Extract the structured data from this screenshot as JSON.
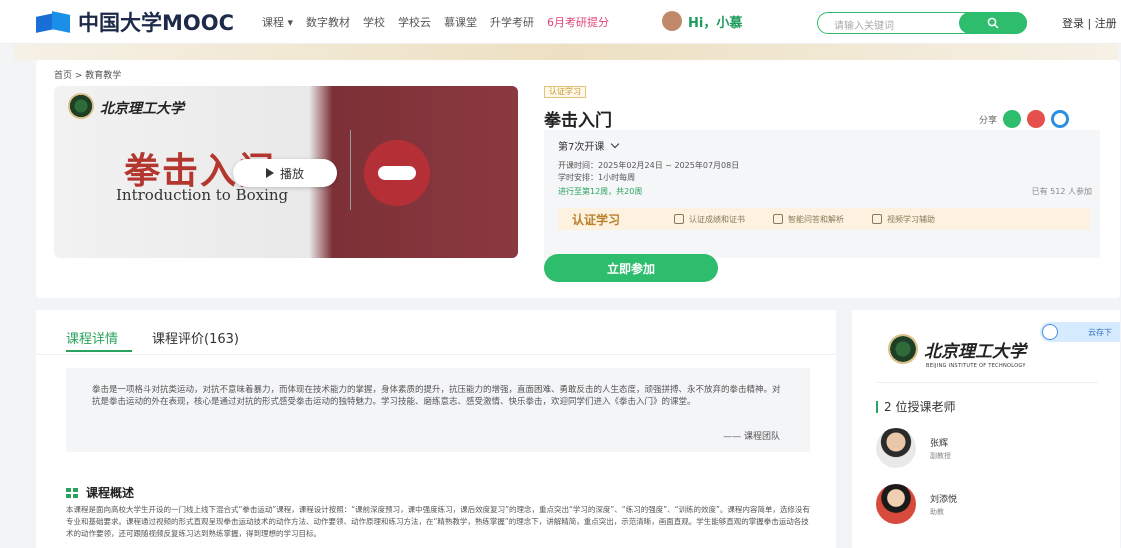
{
  "brand": {
    "logo_text": "中国大学MOOC"
  },
  "nav": {
    "items": [
      "课程 ▾",
      "数字教材",
      "学校",
      "学校云",
      "慕课堂",
      "升学考研"
    ],
    "promo": "6月考研提分",
    "greeting": "Hi，小慕"
  },
  "search": {
    "placeholder": "请输入关键词"
  },
  "account": {
    "login_register": "登录 | 注册"
  },
  "breadcrumb": "首页 > 教育教学",
  "cover": {
    "university": "北京理工大学",
    "title_cn": "拳击入门",
    "title_en": "Introduction to Boxing",
    "play_label": "播放"
  },
  "course": {
    "tag": "认证学习",
    "title": "拳击入门",
    "share_label": "分享",
    "term": "第7次开课",
    "dates": "开课时间：2025年02月24日 ~ 2025年07月08日",
    "schedule": "学时安排：1小时每周",
    "progress": "进行至第12周，共20周",
    "enrolled": "已有 512 人参加",
    "cert_heading": "认证学习",
    "cert_items": [
      "认证成绩和证书",
      "智能问答和解析",
      "视频学习辅助"
    ],
    "join_label": "立即参加"
  },
  "tabs": [
    {
      "label": "课程详情"
    },
    {
      "label": "课程评价(163)"
    }
  ],
  "intro": {
    "text": "拳击是一项格斗对抗类运动，对抗不意味着暴力，而体现在技术能力的掌握，身体素质的提升，抗压能力的增强，直面困难、勇敢反击的人生态度，顽强拼搏、永不放弃的拳击精神。对抗是拳击运动的外在表现，核心是通过对抗的形式感受拳击运动的独特魅力。学习技能、磨练意志、感受激情、快乐拳击，欢迎同学们进入《拳击入门》的课堂。",
    "signature": "—— 课程团队"
  },
  "overview": {
    "heading": "课程概述",
    "text": "本课程是面向高校大学生开设的一门线上线下混合式“拳击运动”课程，课程设计按照：“课前深度预习，课中强度练习，课后效度复习”的理念，重点突出“学习的深度”、“练习的强度”、“训练的效度”。课程内容简单，选修没有专业和基础要求。课程通过视频的形式直观呈现拳击运动技术的动作方法、动作要领、动作原理和练习方法，在“精熟教学，熟练掌握”的理念下，讲解精简，重点突出，示范清晰，画面直观。学生能够直观的掌握拳击运动各技术的动作要领，还可跟随视频反复练习达到熟练掌握，得到理想的学习目标。"
  },
  "sidebar": {
    "university_logo": "北京理工大学",
    "university_en": "BEIJING INSTITUTE OF TECHNOLOGY",
    "cloud_label": "云存下",
    "teachers_heading": "2 位授课老师",
    "teachers": [
      {
        "name": "张辉",
        "role": "副教授"
      },
      {
        "name": "刘添悦",
        "role": "助教"
      }
    ]
  },
  "colors": {
    "accent": "#2ebd6d",
    "brand": "#1a6fd6",
    "cert": "#b9802a"
  }
}
